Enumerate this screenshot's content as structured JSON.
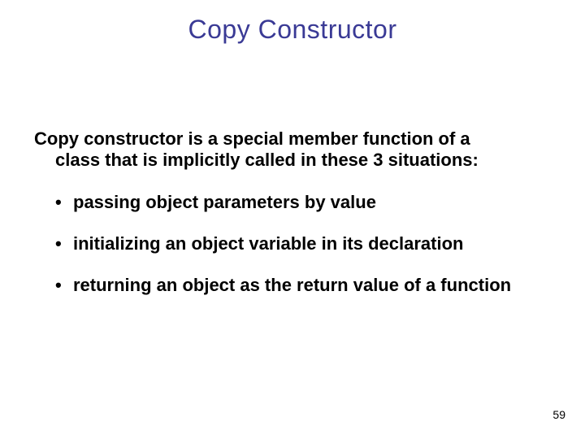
{
  "title": "Copy Constructor",
  "intro_line1": "Copy constructor is a special member function of a",
  "intro_line2": "class that is implicitly called in these 3 situations:",
  "bullets": [
    "passing object parameters by value",
    "initializing an object variable in its declaration",
    "returning an object as the return value of a function"
  ],
  "page_number": "59"
}
